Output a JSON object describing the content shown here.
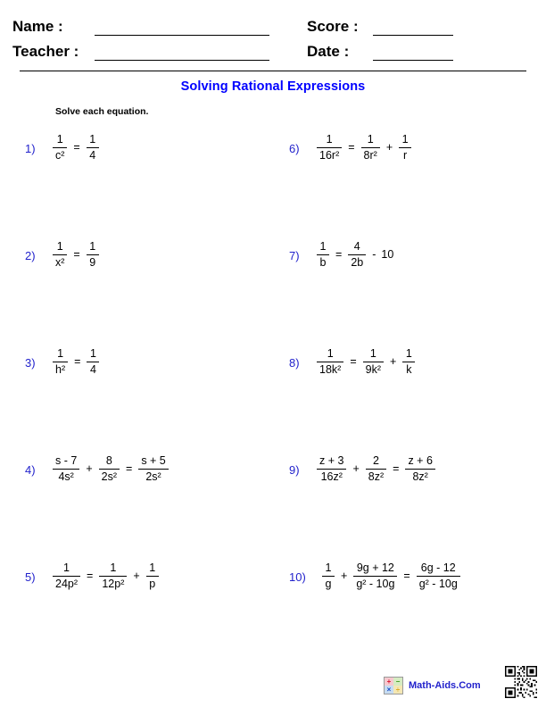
{
  "header": {
    "name_label": "Name :",
    "teacher_label": "Teacher :",
    "score_label": "Score :",
    "date_label": "Date :",
    "name_value": "",
    "teacher_value": "",
    "score_value": "",
    "date_value": ""
  },
  "title": "Solving Rational Expressions",
  "directions": "Solve each equation.",
  "colors": {
    "title_blue": "#0000ff",
    "number_blue": "#2222cc",
    "text_black": "#000000"
  },
  "problems": [
    {
      "number": "1)",
      "latex": "1/c^2 = 1/4",
      "parts": [
        {
          "kind": "frac",
          "num": "1",
          "den": "c²"
        },
        {
          "kind": "op",
          "text": "="
        },
        {
          "kind": "frac",
          "num": "1",
          "den": "4"
        }
      ]
    },
    {
      "number": "6)",
      "latex": "1/(16r^2) = 1/(8r^2) + 1/r",
      "parts": [
        {
          "kind": "frac",
          "num": "1",
          "den": "16r²"
        },
        {
          "kind": "op",
          "text": "="
        },
        {
          "kind": "frac",
          "num": "1",
          "den": "8r²"
        },
        {
          "kind": "op",
          "text": "+"
        },
        {
          "kind": "frac",
          "num": "1",
          "den": "r"
        }
      ]
    },
    {
      "number": "2)",
      "latex": "1/x^2 = 1/9",
      "parts": [
        {
          "kind": "frac",
          "num": "1",
          "den": "x²"
        },
        {
          "kind": "op",
          "text": "="
        },
        {
          "kind": "frac",
          "num": "1",
          "den": "9"
        }
      ]
    },
    {
      "number": "7)",
      "latex": "1/b = 4/(2b) - 10",
      "parts": [
        {
          "kind": "frac",
          "num": "1",
          "den": "b"
        },
        {
          "kind": "op",
          "text": "="
        },
        {
          "kind": "frac",
          "num": "4",
          "den": "2b"
        },
        {
          "kind": "op",
          "text": "-"
        },
        {
          "kind": "term",
          "text": "10"
        }
      ]
    },
    {
      "number": "3)",
      "latex": "1/h^2 = 1/4",
      "parts": [
        {
          "kind": "frac",
          "num": "1",
          "den": "h²"
        },
        {
          "kind": "op",
          "text": "="
        },
        {
          "kind": "frac",
          "num": "1",
          "den": "4"
        }
      ]
    },
    {
      "number": "8)",
      "latex": "1/(18k^2) = 1/(9k^2) + 1/k",
      "parts": [
        {
          "kind": "frac",
          "num": "1",
          "den": "18k²"
        },
        {
          "kind": "op",
          "text": "="
        },
        {
          "kind": "frac",
          "num": "1",
          "den": "9k²"
        },
        {
          "kind": "op",
          "text": "+"
        },
        {
          "kind": "frac",
          "num": "1",
          "den": "k"
        }
      ]
    },
    {
      "number": "4)",
      "latex": "(s-7)/(4s^2) + 8/(2s^2) = (s+5)/(2s^2)",
      "parts": [
        {
          "kind": "frac",
          "num": "s - 7",
          "den": "4s²"
        },
        {
          "kind": "op",
          "text": "+"
        },
        {
          "kind": "frac",
          "num": "8",
          "den": "2s²"
        },
        {
          "kind": "op",
          "text": "="
        },
        {
          "kind": "frac",
          "num": "s + 5",
          "den": "2s²"
        }
      ]
    },
    {
      "number": "9)",
      "latex": "(z+3)/(16z^2) + 2/(8z^2) = (z+6)/(8z^2)",
      "parts": [
        {
          "kind": "frac",
          "num": "z + 3",
          "den": "16z²"
        },
        {
          "kind": "op",
          "text": "+"
        },
        {
          "kind": "frac",
          "num": "2",
          "den": "8z²"
        },
        {
          "kind": "op",
          "text": "="
        },
        {
          "kind": "frac",
          "num": "z + 6",
          "den": "8z²"
        }
      ]
    },
    {
      "number": "5)",
      "latex": "1/(24p^2) = 1/(12p^2) + 1/p",
      "parts": [
        {
          "kind": "frac",
          "num": "1",
          "den": "24p²"
        },
        {
          "kind": "op",
          "text": "="
        },
        {
          "kind": "frac",
          "num": "1",
          "den": "12p²"
        },
        {
          "kind": "op",
          "text": "+"
        },
        {
          "kind": "frac",
          "num": "1",
          "den": "p"
        }
      ]
    },
    {
      "number": "10)",
      "latex": "1/g + (9g+12)/(g^2-10g) = (6g-12)/(g^2-10g)",
      "parts": [
        {
          "kind": "frac",
          "num": "1",
          "den": "g"
        },
        {
          "kind": "op",
          "text": "+"
        },
        {
          "kind": "frac",
          "num": "9g + 12",
          "den": "g² - 10g"
        },
        {
          "kind": "op",
          "text": "="
        },
        {
          "kind": "frac",
          "num": "6g - 12",
          "den": "g² - 10g"
        }
      ]
    }
  ],
  "footer": {
    "brand_text": "Math-Aids.Com",
    "logo_tiles": [
      "+",
      "−",
      "×",
      "÷"
    ],
    "qr_code": "qr-code"
  }
}
